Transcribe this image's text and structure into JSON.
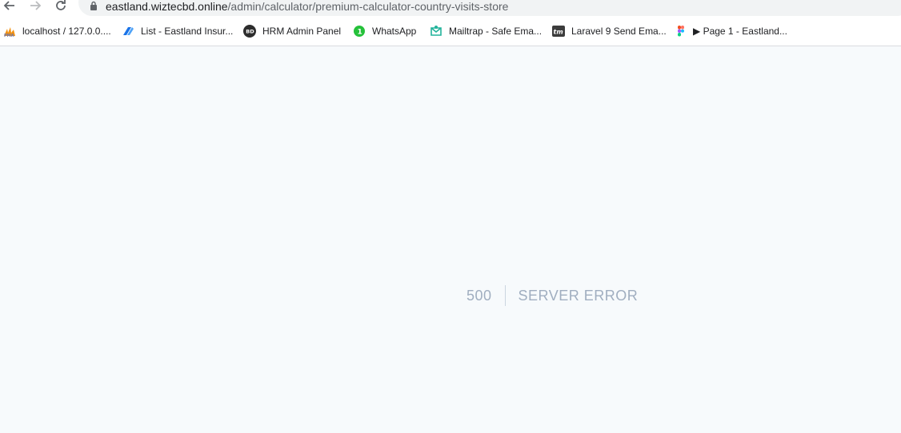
{
  "browser": {
    "url_host": "eastland.wiztecbd.online",
    "url_path": "/admin/calculator/premium-calculator-country-visits-store"
  },
  "bookmarks": [
    {
      "label": "localhost / 127.0.0....",
      "icon": "phpmyadmin-icon"
    },
    {
      "label": "List - Eastland Insur...",
      "icon": "bookmark-icon"
    },
    {
      "label": "HRM Admin Panel",
      "icon": "bd-logo-icon"
    },
    {
      "label": "WhatsApp",
      "icon": "whatsapp-icon"
    },
    {
      "label": "Mailtrap - Safe Ema...",
      "icon": "mailtrap-icon"
    },
    {
      "label": "Laravel 9 Send Ema...",
      "icon": "tm-logo-icon"
    },
    {
      "label": "",
      "icon": "figma-icon"
    },
    {
      "label": "▶ Page 1 - Eastland...",
      "icon": ""
    }
  ],
  "error": {
    "code": "500",
    "message": "Server Error"
  },
  "colors": {
    "page_bg": "#f7fafc",
    "error_text": "#a0aec0"
  }
}
